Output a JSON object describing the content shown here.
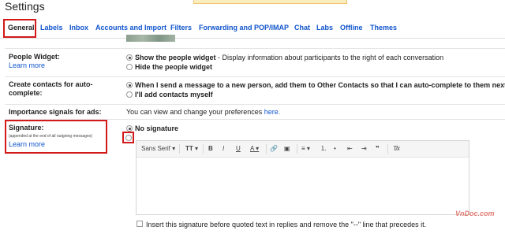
{
  "page": {
    "title": "Settings"
  },
  "tabs": [
    "General",
    "Labels",
    "Inbox",
    "Accounts and Import",
    "Filters",
    "Forwarding and POP/IMAP",
    "Chat",
    "Labs",
    "Offline",
    "Themes"
  ],
  "people_widget": {
    "label": "People Widget:",
    "learn_more": "Learn more",
    "option_show_bold": "Show the people widget",
    "option_show_rest": " - Display information about participants to the right of each conversation",
    "option_hide": "Hide the people widget"
  },
  "create_contacts": {
    "label_line1": "Create contacts for auto-",
    "label_line2": "complete:",
    "option_auto": "When I send a message to a new person, add them to Other Contacts so that I can auto-complete to them next time.",
    "option_manual": "I'll add contacts myself"
  },
  "importance": {
    "label": "Importance signals for ads:",
    "text": "You can view and change your preferences ",
    "link": "here."
  },
  "signature": {
    "label": "Signature:",
    "note": "(appended at the end of all outgoing messages)",
    "learn_more": "Learn more",
    "option_none": "No signature",
    "toolbar": {
      "font": "Sans Serif",
      "font_arrow": "▾",
      "size_icon": "TT",
      "bold": "B",
      "italic": "I",
      "underline": "U",
      "text_color": "A",
      "link_icon": "🔗",
      "image_icon": "▣",
      "align_icon": "≡",
      "numbered_icon": "⒈",
      "bulleted_icon": "•",
      "indent_less_icon": "⇤",
      "indent_more_icon": "⇥",
      "quote_icon": "❞",
      "clear_icon": "T̸x"
    },
    "insert_before_quote": "Insert this signature before quoted text in replies and remove the \"--\" line that precedes it."
  },
  "watermark": "VnDoc.com",
  "colors": {
    "highlight_border": "#d21a1a",
    "link": "#1155cc"
  }
}
